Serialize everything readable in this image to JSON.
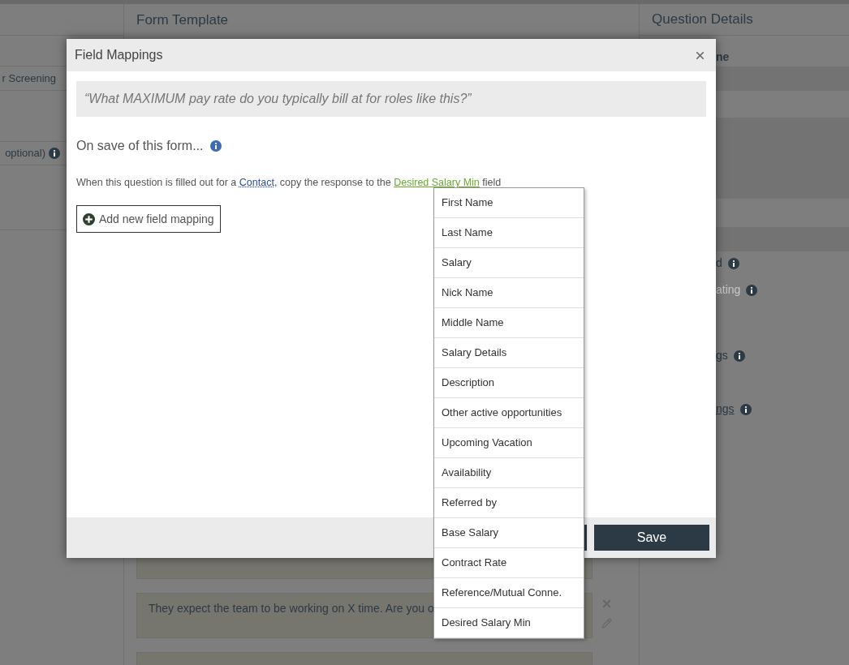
{
  "page": {
    "left_column": {
      "items": [
        {
          "text": "r Screening",
          "info": false
        },
        {
          "text": "optional)",
          "info": true
        }
      ]
    },
    "form_template": {
      "title": "Form Template",
      "cards": [
        {
          "text": "They expect the team to be working on X time. Are you o"
        }
      ]
    },
    "question_details": {
      "title": "Question Details",
      "items": [
        {
          "text": "ne",
          "kind": "bold",
          "info": false
        },
        {
          "text": "d",
          "kind": "plain",
          "info": true
        },
        {
          "text": "ating",
          "kind": "muted",
          "info": true
        },
        {
          "text": "gs",
          "kind": "plain",
          "info": true
        },
        {
          "text": "ngs",
          "kind": "link",
          "info": true
        }
      ]
    }
  },
  "dialog": {
    "title": "Field Mappings",
    "question": "“What MAXIMUM pay rate do you typically bill at for roles like this?”",
    "section_label": "On save of this form...",
    "mapping": {
      "prefix": "When this question is filled out for a",
      "record_link": "Contact",
      "middle": ", copy the response to the",
      "field_link": "Desired Salary Min",
      "suffix": "field"
    },
    "add_button": "Add new field mapping",
    "save_button": "Save",
    "field_options": [
      "First Name",
      "Last Name",
      "Salary",
      "Nick Name",
      "Middle Name",
      "Salary Details",
      "Description",
      "Other active opportunities",
      "Upcoming Vacation",
      "Availability",
      "Referred by",
      "Base Salary",
      "Contract Rate",
      "Reference/Mutual Conne.",
      "Desired Salary Min"
    ]
  }
}
